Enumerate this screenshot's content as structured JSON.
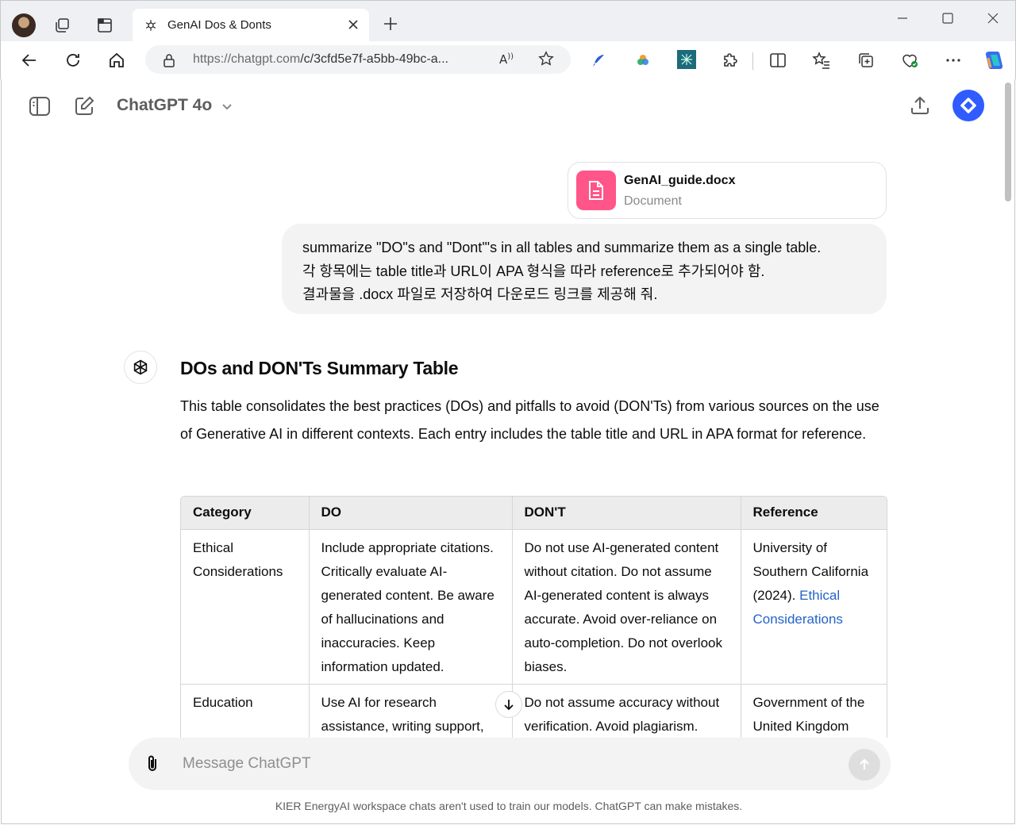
{
  "browser": {
    "tab_title": "GenAI Dos & Donts",
    "url_host": "https://chatgpt.com",
    "url_path": "/c/3cfd5e7f-a5bb-49bc-a..."
  },
  "header": {
    "model": "ChatGPT 4o"
  },
  "attachment": {
    "filename": "GenAI_guide.docx",
    "type": "Document"
  },
  "user_message": {
    "lines": [
      "summarize \"DO\"s and \"Dont'\"s in all tables and summarize them as a single table.",
      "각 항목에는 table title과 URL이 APA 형식을 따라 reference로 추가되어야 함.",
      "결과물을 .docx 파일로 저장하여 다운로드 링크를 제공해 줘."
    ]
  },
  "response": {
    "title": "DOs and DON'Ts Summary Table",
    "paragraph": "This table consolidates the best practices (DOs) and pitfalls to avoid (DON'Ts) from various sources on the use of Generative AI in different contexts. Each entry includes the table title and URL in APA format for reference.",
    "table": {
      "headers": [
        "Category",
        "DO",
        "DON'T",
        "Reference"
      ],
      "rows": [
        {
          "category": "Ethical Considerations",
          "do": "Include appropriate citations. Critically evaluate AI-generated content. Be aware of hallucinations and inaccuracies. Keep information updated.",
          "dont": "Do not use AI-generated content without citation. Do not assume AI-generated content is always accurate. Avoid over-reliance on auto-completion. Do not overlook biases.",
          "ref_text": "University of Southern California (2024).",
          "ref_link": "Ethical Considerations"
        },
        {
          "category": "Education",
          "do": "Use AI for research assistance, writing support,",
          "dont": "Do not assume accuracy without verification. Avoid plagiarism.",
          "ref_text": "Government of the United Kingdom",
          "ref_link": ""
        }
      ]
    }
  },
  "composer": {
    "placeholder": "Message ChatGPT"
  },
  "footer": {
    "note": "KIER EnergyAI workspace chats aren't used to train our models. ChatGPT can make mistakes."
  },
  "colors": {
    "accent_blue": "#2f5bff",
    "doc_icon_pink": "#ff5588",
    "link_blue": "#2264c9"
  }
}
